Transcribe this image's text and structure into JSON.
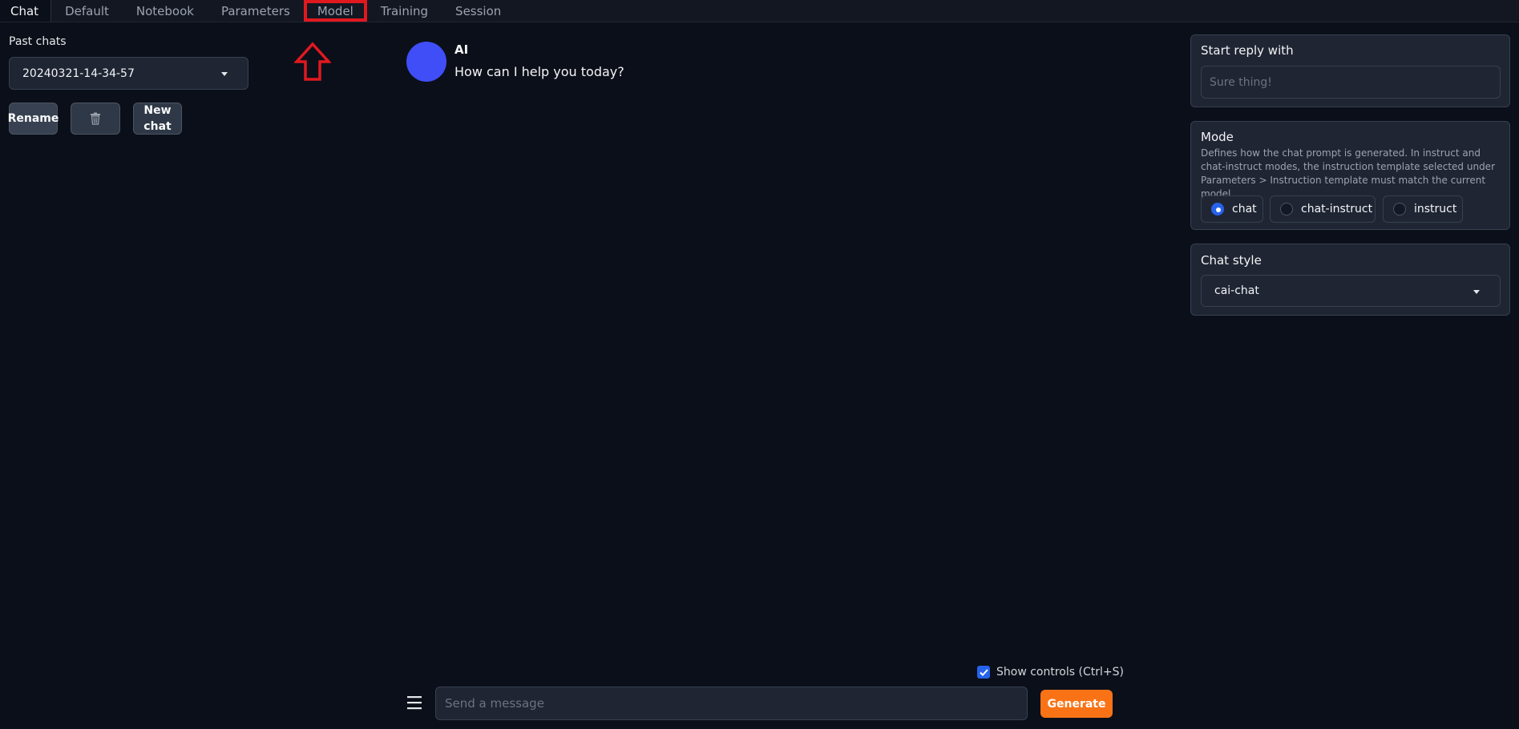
{
  "tabs": [
    {
      "label": "Chat",
      "active": true
    },
    {
      "label": "Default",
      "active": false
    },
    {
      "label": "Notebook",
      "active": false
    },
    {
      "label": "Parameters",
      "active": false
    },
    {
      "label": "Model",
      "active": false,
      "highlighted": true
    },
    {
      "label": "Training",
      "active": false
    },
    {
      "label": "Session",
      "active": false
    }
  ],
  "left_panel": {
    "past_chats_label": "Past chats",
    "selected_chat": "20240321-14-34-57",
    "rename_label": "Rename",
    "delete_icon": "trash-icon",
    "new_chat_label": "New chat"
  },
  "chat": {
    "messages": [
      {
        "name": "AI",
        "text": "How can I help you today?"
      }
    ]
  },
  "input_area": {
    "show_controls_label": "Show controls (Ctrl+S)",
    "show_controls_checked": true,
    "placeholder": "Send a message",
    "value": "",
    "generate_label": "Generate"
  },
  "right_panel": {
    "start_reply": {
      "title": "Start reply with",
      "placeholder": "Sure thing!"
    },
    "mode": {
      "title": "Mode",
      "description": "Defines how the chat prompt is generated. In instruct and chat-instruct modes, the instruction template selected under Parameters > Instruction template must match the current model.",
      "options": [
        "chat",
        "chat-instruct",
        "instruct"
      ],
      "selected": "chat"
    },
    "chat_style": {
      "title": "Chat style",
      "selected": "cai-chat"
    }
  },
  "colors": {
    "background": "#0b0f19",
    "panel": "#1f2533",
    "accent": "#f97316",
    "avatar": "#3f4ef7",
    "highlight": "#e0191f"
  }
}
